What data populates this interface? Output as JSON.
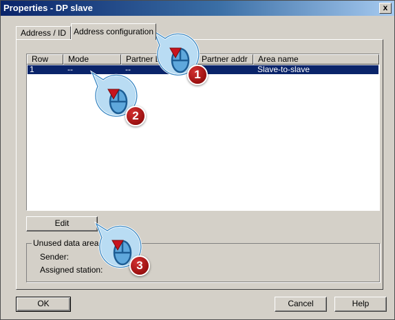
{
  "window": {
    "title": "Properties - DP slave",
    "close_label": "x"
  },
  "tabs": [
    {
      "label": "Address / ID",
      "selected": false
    },
    {
      "label": "Address configuration",
      "selected": true
    }
  ],
  "table": {
    "columns": [
      "Row",
      "Mode",
      "Partner DP",
      "Partner addr",
      "Area name"
    ],
    "rows": [
      {
        "row": "1",
        "mode": "--",
        "partner_dp": "--",
        "partner_addr": "",
        "area_name": "Slave-to-slave",
        "selected": true
      }
    ]
  },
  "buttons": {
    "edit": "Edit",
    "ok": "OK",
    "cancel": "Cancel",
    "help": "Help"
  },
  "unused_data_area": {
    "title": "Unused data area",
    "sender_label": "Sender:",
    "assigned_station_label": "Assigned station:"
  },
  "callouts": [
    {
      "number": "1",
      "icon": "mouse-click-icon",
      "target": "tab-address-configuration"
    },
    {
      "number": "2",
      "icon": "mouse-click-icon",
      "target": "table-row-1"
    },
    {
      "number": "3",
      "icon": "mouse-click-icon",
      "target": "edit-button"
    }
  ],
  "colors": {
    "titlebar_start": "#0a246a",
    "titlebar_end": "#a6caf0",
    "selection": "#0a246a",
    "dialog_face": "#d4d0c8",
    "callout_bubble": "#a8d4f0",
    "callout_badge": "#9b1010",
    "callout_arrow": "#c8141e"
  }
}
